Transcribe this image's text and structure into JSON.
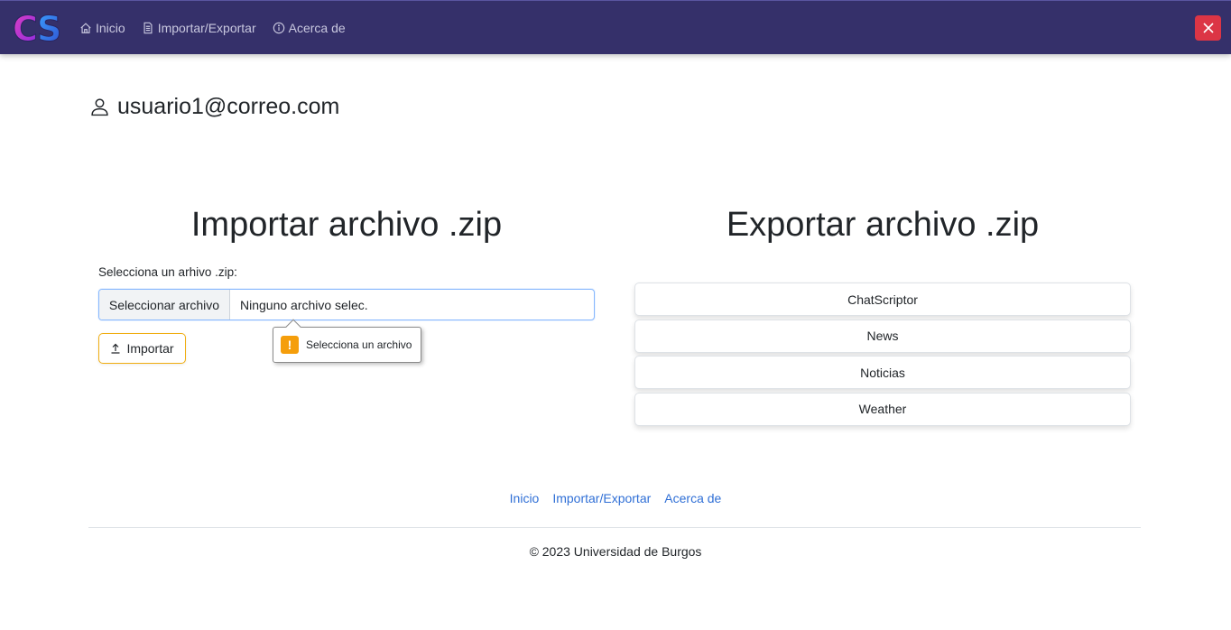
{
  "navbar": {
    "logo_text": "CS",
    "links": [
      {
        "label": "Inicio",
        "icon": "home-icon"
      },
      {
        "label": "Importar/Exportar",
        "icon": "document-icon"
      },
      {
        "label": "Acerca de",
        "icon": "info-icon"
      }
    ],
    "close_icon": "close-icon"
  },
  "user": {
    "icon": "user-icon",
    "email": "usuario1@correo.com"
  },
  "import": {
    "title": "Importar archivo .zip",
    "label": "Selecciona un arhivo .zip:",
    "file_button": "Seleccionar archivo",
    "file_name": "Ninguno archivo selec.",
    "import_button": "Importar",
    "tooltip": "Selecciona un archivo",
    "tooltip_icon_glyph": "!"
  },
  "export": {
    "title": "Exportar archivo .zip",
    "items": [
      "ChatScriptor",
      "News",
      "Noticias",
      "Weather"
    ]
  },
  "footer": {
    "links": [
      "Inicio",
      "Importar/Exportar",
      "Acerca de"
    ],
    "copyright": "© 2023 Universidad de Burgos"
  },
  "colors": {
    "navbar_bg": "#35306a",
    "close_button": "#dc3545",
    "import_border": "#f0ad10",
    "warning": "#f59e0b",
    "link": "#2f6fd6"
  }
}
